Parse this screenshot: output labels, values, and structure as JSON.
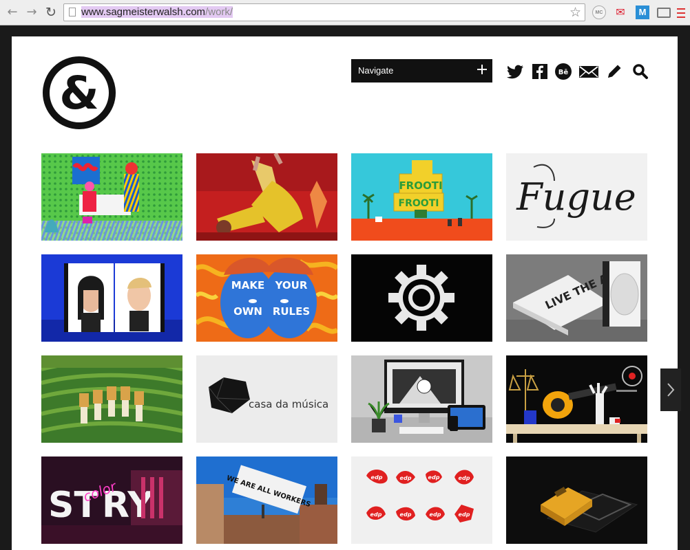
{
  "browser": {
    "url_prefix": "www.sagmeisterwalsh.com",
    "url_path": "/work/",
    "extension_mc": "MC",
    "extension_m": "M"
  },
  "header": {
    "navigate_label": "Navigate"
  },
  "tiles": [
    {
      "name": "pop-art-room-tile",
      "text": ""
    },
    {
      "name": "woman-yellow-dress-tile",
      "text": ""
    },
    {
      "name": "frooti-tile",
      "text": "FROOTI"
    },
    {
      "name": "fugue-tile",
      "text": "Fugue"
    },
    {
      "name": "40-days-of-dating-tile",
      "text": ""
    },
    {
      "name": "make-your-own-rules-tile",
      "text": "MAKE YOUR OWN RULES"
    },
    {
      "name": "gear-logo-tile",
      "text": ""
    },
    {
      "name": "live-the-art-tile",
      "text": "LIVE THE ART"
    },
    {
      "name": "rice-terrace-tile",
      "text": ""
    },
    {
      "name": "casa-da-musica-tile",
      "text": "casa da música"
    },
    {
      "name": "website-devices-tile",
      "text": ""
    },
    {
      "name": "leaf-blower-still-life-tile",
      "text": ""
    },
    {
      "name": "story-neon-tile",
      "text": "ST  RY"
    },
    {
      "name": "we-are-all-workers-tile",
      "text": "WE ARE ALL WORKERS"
    },
    {
      "name": "edp-logos-tile",
      "text": "edp"
    },
    {
      "name": "mousetrap-tile",
      "text": ""
    }
  ],
  "colors": {
    "page_bg": "#ffffff",
    "frame_bg": "#1a1a1a",
    "navigate_bg": "#111111"
  }
}
